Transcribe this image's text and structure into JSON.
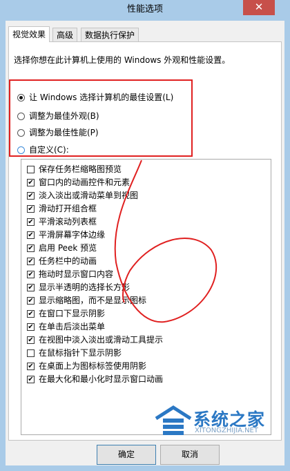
{
  "window": {
    "title": "性能选项",
    "close_glyph": "✕"
  },
  "tabs": [
    {
      "label": "视觉效果",
      "active": true
    },
    {
      "label": "高级",
      "active": false
    },
    {
      "label": "数据执行保护",
      "active": false
    }
  ],
  "description": "选择你想在此计算机上使用的 Windows 外观和性能设置。",
  "radios": [
    {
      "label": "让 Windows 选择计算机的最佳设置(L)",
      "checked": true
    },
    {
      "label": "调整为最佳外观(B)",
      "checked": false
    },
    {
      "label": "调整为最佳性能(P)",
      "checked": false
    },
    {
      "label": "自定义(C):",
      "checked": false
    }
  ],
  "options": [
    {
      "label": "保存任务栏缩略图预览",
      "checked": false
    },
    {
      "label": "窗口内的动画控件和元素",
      "checked": true
    },
    {
      "label": "淡入淡出或滑动菜单到视图",
      "checked": true
    },
    {
      "label": "滑动打开组合框",
      "checked": true
    },
    {
      "label": "平滑滚动列表框",
      "checked": true
    },
    {
      "label": "平滑屏幕字体边缘",
      "checked": true
    },
    {
      "label": "启用 Peek 预览",
      "checked": true
    },
    {
      "label": "任务栏中的动画",
      "checked": true
    },
    {
      "label": "拖动时显示窗口内容",
      "checked": true
    },
    {
      "label": "显示半透明的选择长方形",
      "checked": true
    },
    {
      "label": "显示缩略图，而不是显示图标",
      "checked": true
    },
    {
      "label": "在窗口下显示阴影",
      "checked": true
    },
    {
      "label": "在单击后淡出菜单",
      "checked": true
    },
    {
      "label": "在视图中淡入淡出或滑动工具提示",
      "checked": true
    },
    {
      "label": "在鼠标指针下显示阴影",
      "checked": false
    },
    {
      "label": "在桌面上为图标标签使用阴影",
      "checked": true
    },
    {
      "label": "在最大化和最小化时显示窗口动画",
      "checked": true
    }
  ],
  "buttons": {
    "ok": "确定",
    "cancel": "取消"
  },
  "check_glyph": "✔",
  "watermark": {
    "brand": "系统之家",
    "url": "XITONGZHIJIA.NET"
  },
  "colors": {
    "title_bar": "#a9cbe8",
    "close": "#c7504a",
    "annotation": "#e02020",
    "watermark": "#2b78c4"
  }
}
